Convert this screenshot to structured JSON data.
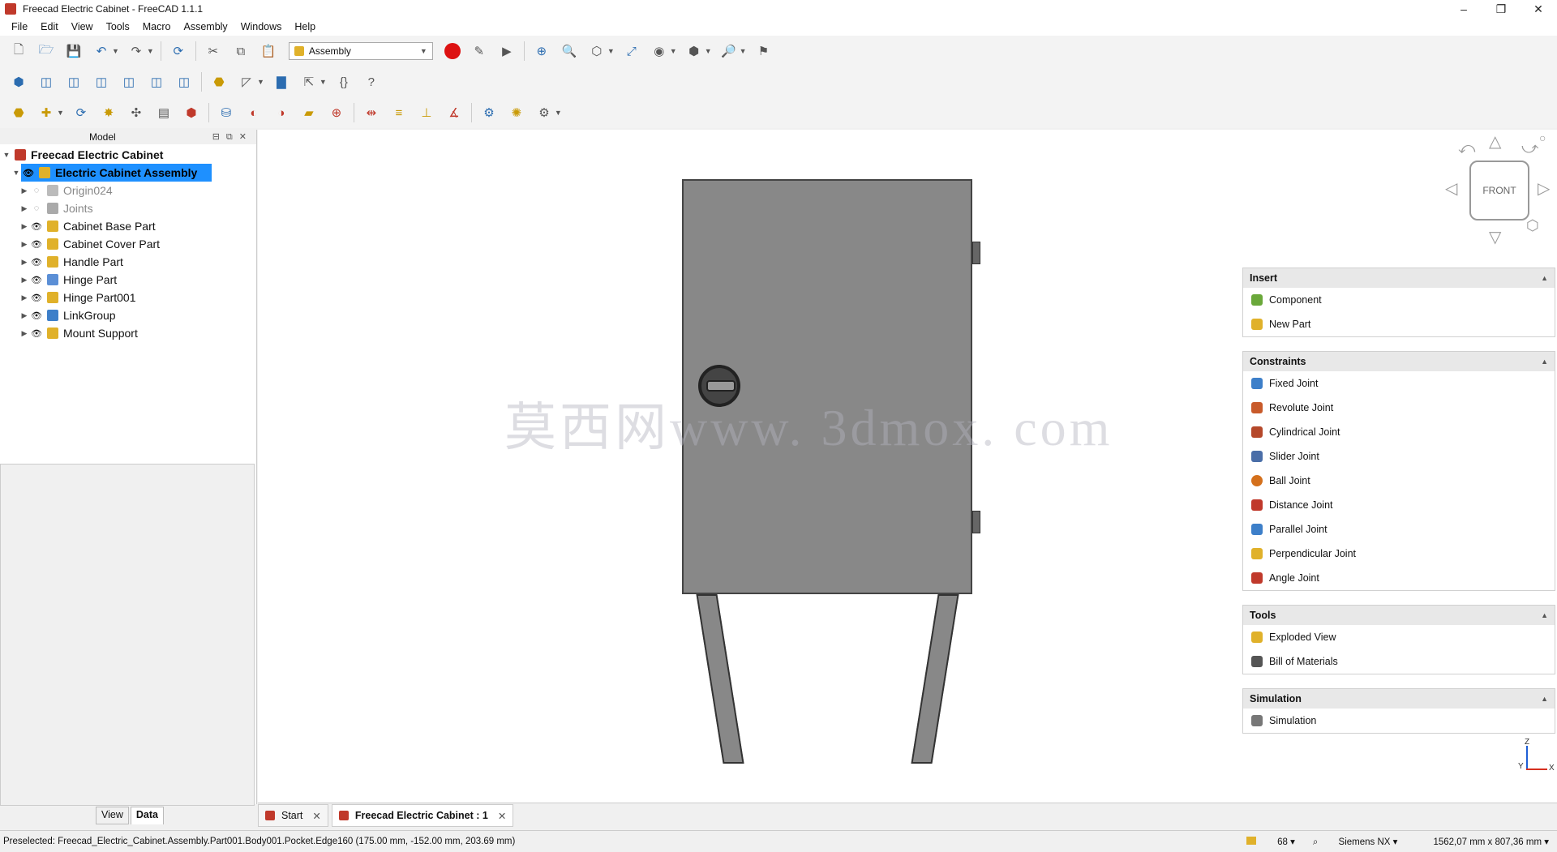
{
  "window": {
    "title": "Freecad Electric Cabinet - FreeCAD 1.1.1",
    "controls": [
      "–",
      "❐",
      "✕"
    ]
  },
  "menu": [
    "File",
    "Edit",
    "View",
    "Tools",
    "Macro",
    "Assembly",
    "Windows",
    "Help"
  ],
  "toolbar": {
    "workbench": "Assembly"
  },
  "model_panel": {
    "header": "Model",
    "tree": [
      {
        "label": "Freecad Electric Cabinet",
        "level": 0,
        "bold": true
      },
      {
        "label": "Electric Cabinet Assembly",
        "level": 1,
        "selected": true
      },
      {
        "label": "Origin024",
        "level": 2,
        "dim": true
      },
      {
        "label": "Joints",
        "level": 2,
        "dim": true
      },
      {
        "label": "Cabinet Base Part",
        "level": 2
      },
      {
        "label": "Cabinet Cover Part",
        "level": 2
      },
      {
        "label": "Handle Part",
        "level": 2
      },
      {
        "label": "Hinge Part",
        "level": 2
      },
      {
        "label": "Hinge Part001",
        "level": 2
      },
      {
        "label": "LinkGroup",
        "level": 2
      },
      {
        "label": "Mount Support",
        "level": 2
      }
    ],
    "tabs": [
      "View",
      "Data"
    ],
    "active_tab": "Data"
  },
  "view3d": {
    "watermark": "莫西网www. 3dmox. com",
    "navcube_face": "FRONT",
    "axis": {
      "x": "X",
      "y": "Y",
      "z": "Z"
    }
  },
  "task_panel": {
    "sections": [
      {
        "title": "Insert",
        "items": [
          "Component",
          "New Part"
        ]
      },
      {
        "title": "Constraints",
        "items": [
          "Fixed Joint",
          "Revolute Joint",
          "Cylindrical Joint",
          "Slider Joint",
          "Ball Joint",
          "Distance Joint",
          "Parallel Joint",
          "Perpendicular Joint",
          "Angle Joint"
        ]
      },
      {
        "title": "Tools",
        "items": [
          "Exploded View",
          "Bill of Materials"
        ]
      },
      {
        "title": "Simulation",
        "items": [
          "Simulation"
        ]
      }
    ]
  },
  "doc_tabs": [
    {
      "label": "Start",
      "active": false
    },
    {
      "label": "Freecad Electric Cabinet : 1",
      "active": true
    }
  ],
  "status": {
    "preselected": "Preselected: Freecad_Electric_Cabinet.Assembly.Part001.Body001.Pocket.Edge160 (175.00 mm, -152.00 mm, 203.69 mm)",
    "count": "68",
    "nav_style": "Siemens NX",
    "dimensions": "1562,07 mm x 807,36 mm"
  },
  "colors": {
    "selection": "#1e90ff",
    "cabinet": "#888888",
    "record": "#dd1111"
  }
}
